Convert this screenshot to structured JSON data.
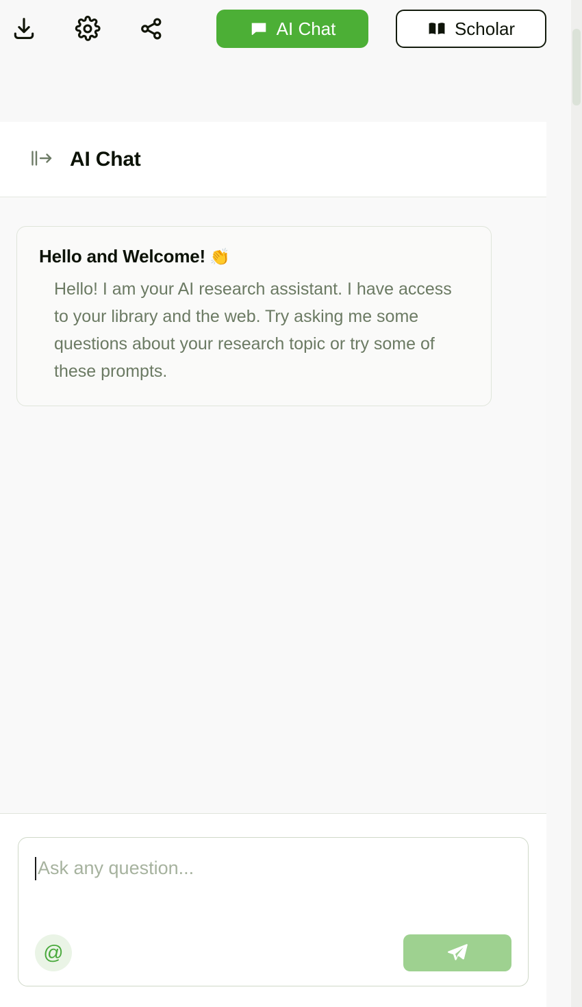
{
  "app": {
    "accent_green": "#4caf36",
    "muted_green": "#9ed190",
    "page_bg": "#f9f9f9",
    "panel_bg": "#ffffff"
  },
  "toolbar": {
    "icons": [
      {
        "name": "download-icon",
        "label": "Download"
      },
      {
        "name": "settings-gear-icon",
        "label": "Settings"
      },
      {
        "name": "share-icon",
        "label": "Share"
      }
    ],
    "ai_chat_label": "AI Chat",
    "scholar_label": "Scholar"
  },
  "chat_header": {
    "toggle_icon": "panel-expand-right-icon",
    "title": "AI Chat"
  },
  "welcome_card": {
    "title": "Hello and Welcome!",
    "emoji": "👏",
    "body": "Hello! I am your AI research assistant. I have access to your library and the web. Try asking me some questions about your research topic or try some of these prompts."
  },
  "composer": {
    "placeholder": "Ask any question...",
    "value": "",
    "mention_label": "@",
    "send_icon": "send-paper-plane-icon"
  },
  "scrollbar": {
    "thumb_color": "#dbe2d8",
    "track_color": "#efefed"
  }
}
